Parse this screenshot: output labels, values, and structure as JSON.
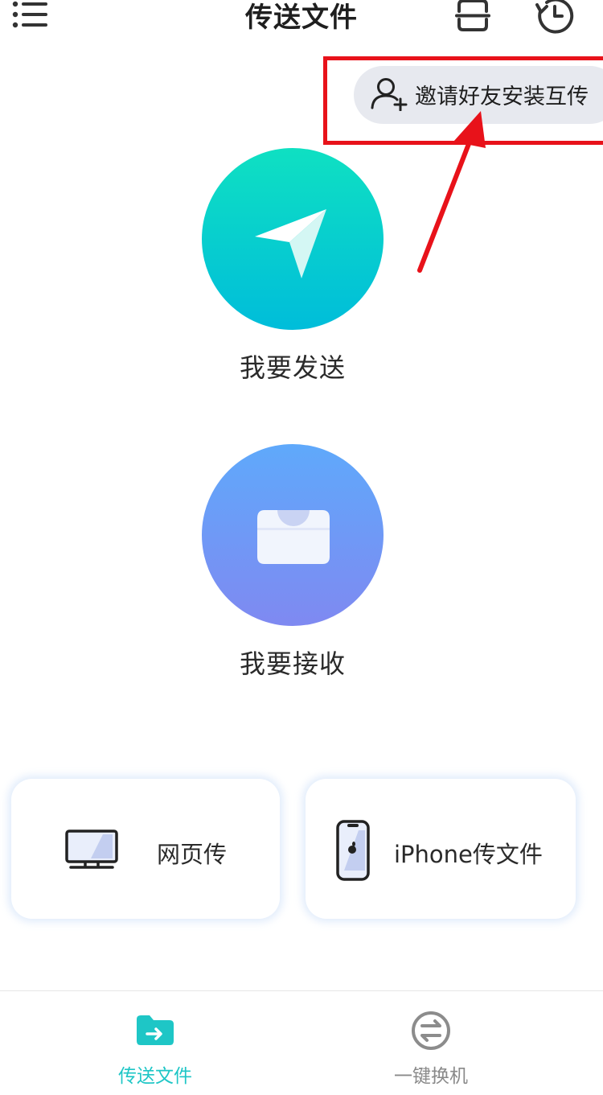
{
  "header": {
    "title": "传送文件"
  },
  "invite": {
    "label": "邀请好友安装互传"
  },
  "actions": {
    "send_label": "我要发送",
    "receive_label": "我要接收"
  },
  "cards": {
    "web_label": "网页传",
    "iphone_label": "iPhone传文件"
  },
  "tabs": [
    {
      "label": "传送文件",
      "active": true
    },
    {
      "label": "一键换机",
      "active": false
    }
  ],
  "icons": {
    "menu": "menu-icon",
    "scan": "scan-icon",
    "history": "history-icon",
    "add_user": "add-user-icon",
    "send": "paper-plane-icon",
    "receive": "inbox-tray-icon",
    "monitor": "monitor-icon",
    "iphone": "iphone-icon",
    "folder": "folder-arrow-icon",
    "swap": "swap-icon"
  },
  "colors": {
    "accent": "#1ec6c6",
    "annotation": "#e8121a",
    "send_gradient": [
      "#0fe0c2",
      "#00bdda"
    ],
    "receive_gradient": [
      "#5fa9fb",
      "#7f89f1"
    ]
  }
}
